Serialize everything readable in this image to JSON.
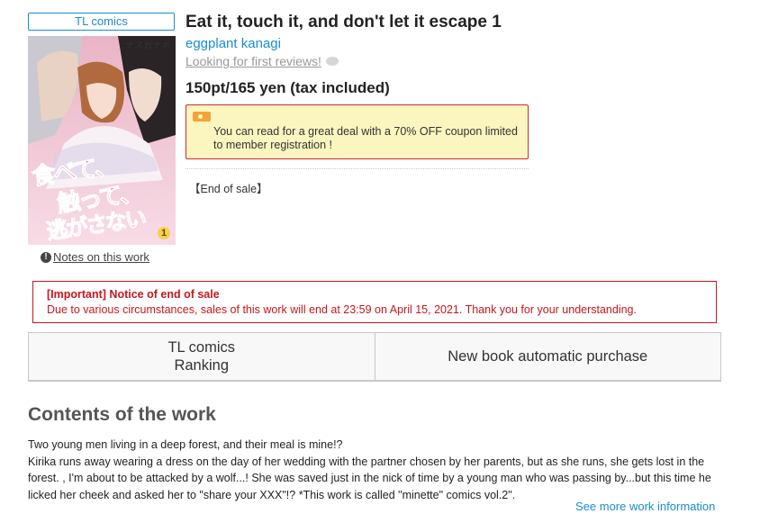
{
  "product": {
    "genre_badge": "TL comics",
    "title": "Eat it, touch it, and don't let it escape 1",
    "author": "eggplant kanagi",
    "reviews_link": "Looking for first reviews!",
    "price": "150pt/165 yen (tax included)",
    "coupon_text": "You can read for a great deal with a 70% OFF coupon limited to member registration !",
    "sale_status": "【End of sale】",
    "notes_link": "Notes on this work"
  },
  "cover": {
    "author_kana": "ナスカナギ",
    "title_line1": "食べて、",
    "title_line2": "触って、",
    "title_line3": "逃がさない",
    "volume": "1"
  },
  "notice": {
    "heading": "[Important] Notice of end of sale",
    "body": "Due to various circumstances, sales of this work will end at 23:59 on April 15, 2021. Thank you for your understanding."
  },
  "actions": {
    "ranking_line1": "TL comics",
    "ranking_line2": "Ranking",
    "auto_purchase": "New book automatic purchase"
  },
  "contents": {
    "heading": "Contents of the work",
    "line1": "Two young men living in a deep forest, and their meal is mine!?",
    "line2": "Kirika runs away wearing a dress on the day of her wedding with the partner chosen by her parents, but as she runs, she gets lost in the forest. , I'm about to be attacked by a wolf...! She was saved just in the nick of time by a young man who was passing by...but this time he licked her cheek and asked her to \"share your XXX\"!? *This work is called \"minette\" comics vol.2\".",
    "more_link": "See more work information"
  },
  "colors": {
    "link_blue": "#1a8bd6",
    "notice_red": "#c8161d",
    "coupon_bg": "#fbf6bf",
    "coupon_icon": "#f2a43a"
  },
  "icons": {
    "notes": "info-icon",
    "reviews": "comment-bubble-icon",
    "coupon": "coupon-ticket-icon"
  }
}
